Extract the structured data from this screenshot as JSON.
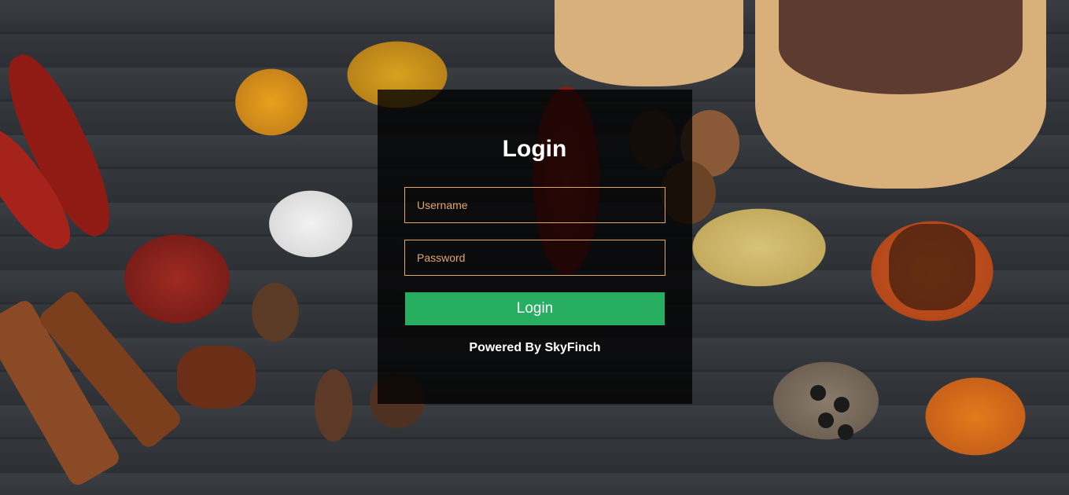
{
  "login": {
    "title": "Login",
    "username_placeholder": "Username",
    "password_placeholder": "Password",
    "submit_label": "Login",
    "powered_by": "Powered By SkyFinch"
  },
  "colors": {
    "card_background": "#000000",
    "input_border": "#e0a865",
    "placeholder_text": "#e6a66a",
    "button_background": "#27ae60",
    "text": "#ffffff"
  },
  "background": {
    "icon": "spices-photo"
  }
}
